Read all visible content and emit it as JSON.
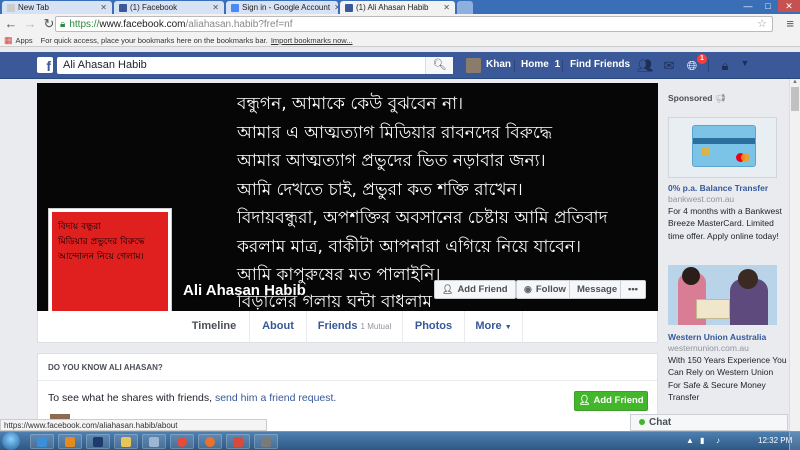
{
  "browser": {
    "tabs": [
      {
        "title": "New Tab",
        "active": false
      },
      {
        "title": "(1) Facebook",
        "active": false
      },
      {
        "title": "Sign in - Google Account",
        "active": false
      },
      {
        "title": "(1) Ali Ahasan Habib",
        "active": true
      }
    ],
    "window_controls": {
      "minimize": "—",
      "maximize": "□",
      "close": "✕"
    },
    "url_scheme": "https://",
    "url_host": "www.facebook.com",
    "url_rest": "/aliahasan.habib?fref=nf",
    "bookmarks_apps": "Apps",
    "bookmarks_hint": "For quick access, place your bookmarks here on the bookmarks bar.",
    "bookmarks_import": "Import bookmarks now..."
  },
  "facebook_bar": {
    "search_value": "Ali Ahasan Habib",
    "user_name": "Khan",
    "home_label": "Home",
    "home_count": "1",
    "find_friends_label": "Find Friends",
    "notification_count": "1"
  },
  "cover": {
    "lines": [
      "বন্ধুগন, আমাকে কেউ বুঝবেন না।",
      "আমার এ আত্মত্যাগ মিডিয়ার রাবনদের বিরুদ্ধে",
      "আমার আত্মত্যাগ প্রভুদের ভিত নড়াবার জন্য।",
      "আমি দেখতে চাই, প্রভুরা কত শক্তি রাখেন।",
      "বিদায়বন্ধুরা,  অপশক্তির অবসানের চেষ্টায় আমি প্রতিবাদ",
      "করলাম মাত্র, বাকীটা আপনারা এগিয়ে নিয়ে যাবেন।",
      "আমি কাপুরুষের মত পালাইনি।",
      "বিড়ালের গলায় ঘন্টা বাধলাম"
    ],
    "profile_pic_lines": [
      "বিদায় বন্ধুরা",
      "মিডিয়ার প্রভুদের বিরুদ্ধে",
      "আন্দোলন নিয়ে গেলাম।"
    ],
    "name": "Ali Ahasan Habib",
    "add_friend_label": "Add Friend",
    "follow_label": "Follow",
    "message_label": "Message",
    "more_label": "•••"
  },
  "profile_tabs": {
    "timeline": "Timeline",
    "about": "About",
    "friends": "Friends",
    "friends_mutual": "1 Mutual",
    "photos": "Photos",
    "more": "More"
  },
  "know_panel": {
    "heading": "DO YOU KNOW ALI AHASAN?",
    "text_prefix": "To see what he shares with friends,",
    "link_text": "send him a friend request.",
    "button_label": "Add Friend"
  },
  "sidebar": {
    "sponsored_label": "Sponsored",
    "ad1": {
      "title": "0% p.a. Balance Transfer",
      "domain": "bankwest.com.au",
      "body": "For 4 months with a Bankwest Breeze MasterCard. Limited time offer. Apply online today!"
    },
    "ad2": {
      "title": "Western Union Australia",
      "domain": "westernunion.com.au",
      "body": "With 150 Years Experience You Can Rely on Western Union For Safe & Secure Money Transfer"
    }
  },
  "status_bar_url": "https://www.facebook.com/aliahasan.habib/about",
  "chat_label": "Chat",
  "taskbar": {
    "time": "12:32 PM"
  },
  "colors": {
    "facebook_blue": "#3b5998",
    "link_blue": "#365899",
    "profile_red": "#e01f1f",
    "add_friend_green": "#42b72a"
  }
}
